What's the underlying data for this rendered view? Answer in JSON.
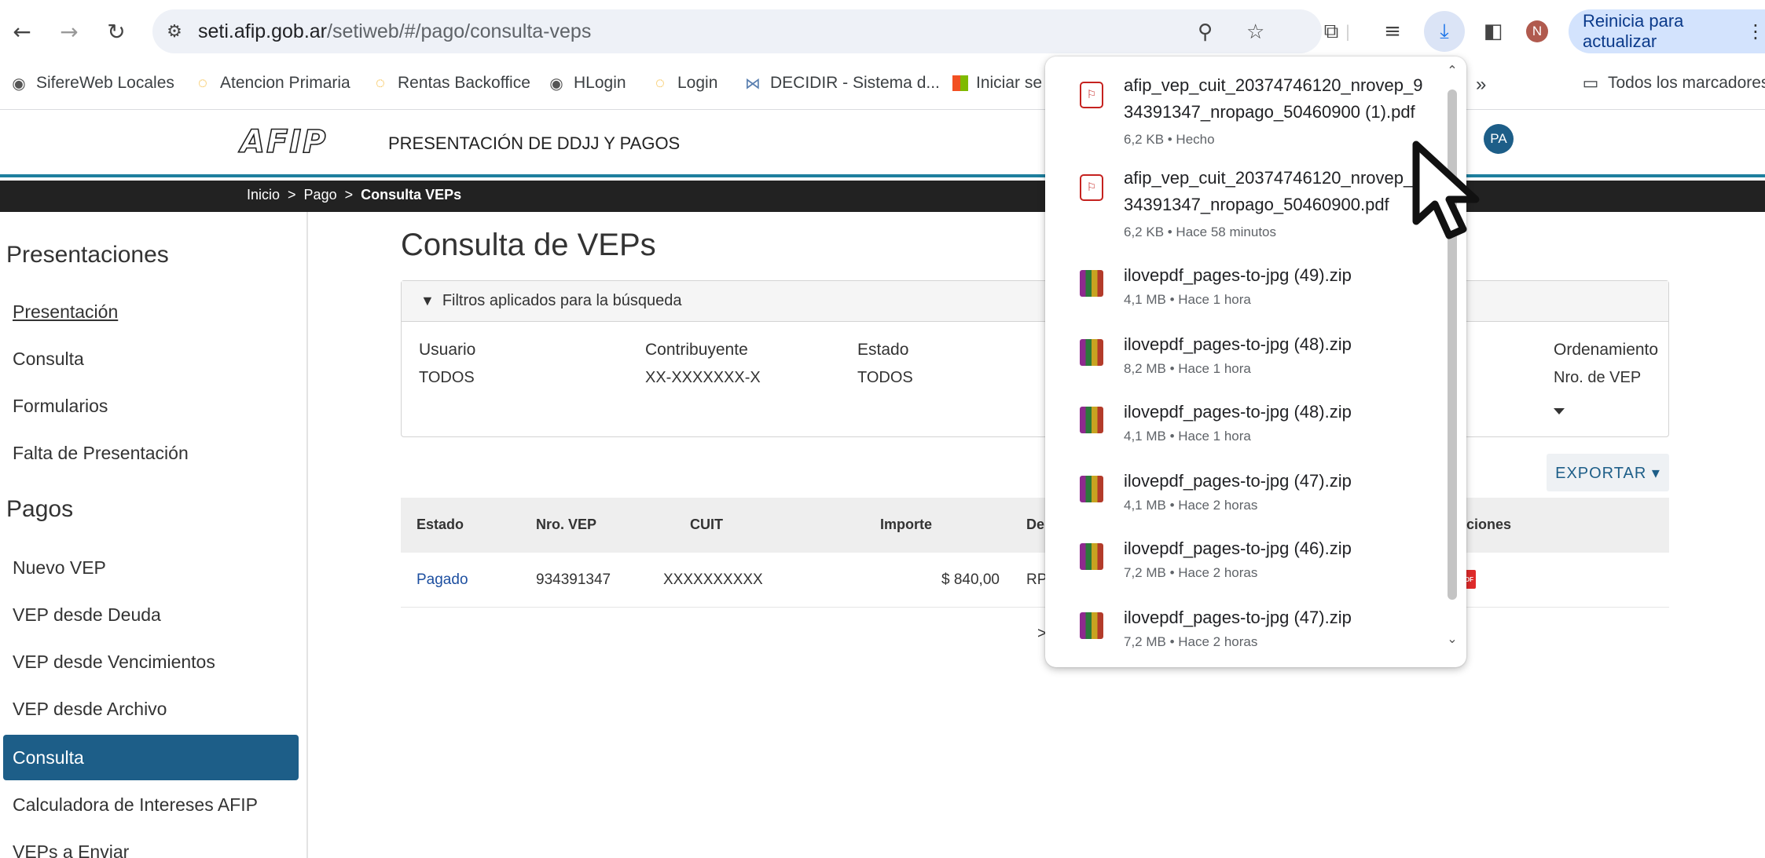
{
  "browser": {
    "url_host": "seti.afip.gob.ar",
    "url_path": "/setiweb/#/pago/consulta-veps",
    "update_button": "Reinicia para actualizar",
    "profile_initial": "N",
    "bookmarks": [
      {
        "label": "SifereWeb Locales",
        "icon": "globe-icon"
      },
      {
        "label": "Atencion Primaria",
        "icon": "loading-icon"
      },
      {
        "label": "Rentas Backoffice",
        "icon": "loading-icon"
      },
      {
        "label": "HLogin",
        "icon": "globe-icon"
      },
      {
        "label": "Login",
        "icon": "loading-icon"
      },
      {
        "label": "DECIDIR - Sistema d...",
        "icon": "decidir-icon"
      },
      {
        "label": "Iniciar se",
        "icon": "microsoft-icon"
      }
    ],
    "all_bookmarks": "Todos los marcadores",
    "overflow": "»"
  },
  "afip": {
    "logo": "AFIP",
    "title": "PRESENTACIÓN DE DDJJ Y PAGOS",
    "user_initials": "PA",
    "breadcrumb": [
      "Inicio",
      "Pago",
      "Consulta VEPs"
    ]
  },
  "sidebar": {
    "section1": "Presentaciones",
    "items1": [
      "Presentación",
      "Consulta",
      "Formularios",
      "Falta de Presentación"
    ],
    "section2": "Pagos",
    "items2": [
      "Nuevo VEP",
      "VEP desde Deuda",
      "VEP desde Vencimientos",
      "VEP desde Archivo",
      "Consulta",
      "Calculadora de Intereses AFIP",
      "VEPs a Enviar"
    ]
  },
  "main": {
    "title": "Consulta de VEPs",
    "filters_title": "Filtros aplicados para la búsqueda",
    "filters": [
      {
        "label": "Usuario",
        "value": "TODOS"
      },
      {
        "label": "Contribuyente",
        "value": "XX-XXXXXXX-X"
      },
      {
        "label": "Estado",
        "value": "TODOS"
      },
      {
        "label": "Ordenamiento",
        "value": "Nro. de VEP"
      }
    ],
    "export": "EXPORTAR ▾",
    "columns": [
      "Estado",
      "Nro. VEP",
      "CUIT",
      "Importe",
      "De",
      "cciones"
    ],
    "row": {
      "estado": "Pagado",
      "nro_vep": "934391347",
      "cuit": "XXXXXXXXXX",
      "importe": "$ 840,00",
      "desc": "RP",
      "extra": ">"
    }
  },
  "downloads": [
    {
      "name_l1": "afip_vep_cuit_20374746120_nrovep_9",
      "name_l2": "34391347_nropago_50460900 (1).pdf",
      "meta": "6,2 KB • Hecho",
      "type": "pdf"
    },
    {
      "name_l1": "afip_vep_cuit_20374746120_nrovep_9",
      "name_l2": "34391347_nropago_50460900.pdf",
      "meta": "6,2 KB • Hace 58 minutos",
      "type": "pdf"
    },
    {
      "name_l1": "ilovepdf_pages-to-jpg (49).zip",
      "meta": "4,1 MB • Hace 1 hora",
      "type": "zip"
    },
    {
      "name_l1": "ilovepdf_pages-to-jpg (48).zip",
      "meta": "8,2 MB • Hace 1 hora",
      "type": "zip"
    },
    {
      "name_l1": "ilovepdf_pages-to-jpg (48).zip",
      "meta": "4,1 MB • Hace 1 hora",
      "type": "zip"
    },
    {
      "name_l1": "ilovepdf_pages-to-jpg (47).zip",
      "meta": "4,1 MB • Hace 2 horas",
      "type": "zip"
    },
    {
      "name_l1": "ilovepdf_pages-to-jpg (46).zip",
      "meta": "7,2 MB • Hace 2 horas",
      "type": "zip"
    },
    {
      "name_l1": "ilovepdf_pages-to-jpg (47).zip",
      "meta": "7,2 MB • Hace 2 horas",
      "type": "zip"
    }
  ]
}
